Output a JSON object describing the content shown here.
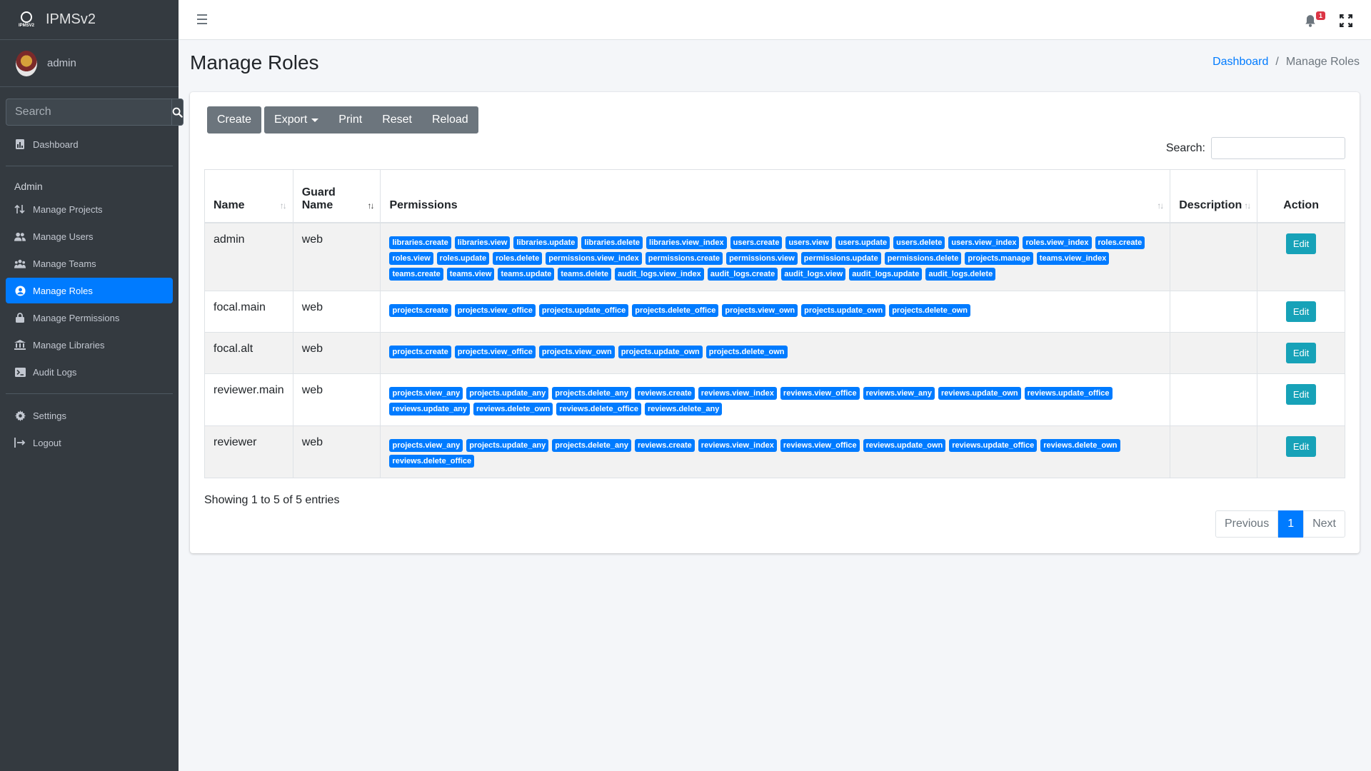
{
  "sidebar": {
    "brand": "IPMSv2",
    "brand_small": "IPMSV2",
    "user": "admin",
    "search_placeholder": "Search",
    "dashboard": "Dashboard",
    "section_header": "Admin",
    "items": [
      {
        "label": "Manage Projects",
        "icon": "sort-arrows-icon"
      },
      {
        "label": "Manage Users",
        "icon": "users-icon"
      },
      {
        "label": "Manage Teams",
        "icon": "teams-icon"
      },
      {
        "label": "Manage Roles",
        "icon": "user-circle-icon"
      },
      {
        "label": "Manage Permissions",
        "icon": "lock-icon"
      },
      {
        "label": "Manage Libraries",
        "icon": "library-icon"
      },
      {
        "label": "Audit Logs",
        "icon": "terminal-icon"
      }
    ],
    "settings": "Settings",
    "logout": "Logout"
  },
  "topbar": {
    "notification_count": "1"
  },
  "header": {
    "title": "Manage Roles",
    "breadcrumb_home": "Dashboard",
    "breadcrumb_sep": "/",
    "breadcrumb_current": "Manage Roles"
  },
  "toolbar": {
    "create": "Create",
    "export": "Export",
    "print": "Print",
    "reset": "Reset",
    "reload": "Reload"
  },
  "search_label": "Search:",
  "table": {
    "columns": [
      "Name",
      "Guard Name",
      "Permissions",
      "Description",
      "Action"
    ],
    "guard_line1": "Guard",
    "guard_line2": "Name",
    "rows": [
      {
        "name": "admin",
        "guard": "web",
        "description": "",
        "action": "Edit",
        "permissions": [
          "libraries.create",
          "libraries.view",
          "libraries.update",
          "libraries.delete",
          "libraries.view_index",
          "users.create",
          "users.view",
          "users.update",
          "users.delete",
          "users.view_index",
          "roles.view_index",
          "roles.create",
          "roles.view",
          "roles.update",
          "roles.delete",
          "permissions.view_index",
          "permissions.create",
          "permissions.view",
          "permissions.update",
          "permissions.delete",
          "projects.manage",
          "teams.view_index",
          "teams.create",
          "teams.view",
          "teams.update",
          "teams.delete",
          "audit_logs.view_index",
          "audit_logs.create",
          "audit_logs.view",
          "audit_logs.update",
          "audit_logs.delete"
        ]
      },
      {
        "name": "focal.main",
        "guard": "web",
        "description": "",
        "action": "Edit",
        "permissions": [
          "projects.create",
          "projects.view_office",
          "projects.update_office",
          "projects.delete_office",
          "projects.view_own",
          "projects.update_own",
          "projects.delete_own"
        ]
      },
      {
        "name": "focal.alt",
        "guard": "web",
        "description": "",
        "action": "Edit",
        "permissions": [
          "projects.create",
          "projects.view_office",
          "projects.view_own",
          "projects.update_own",
          "projects.delete_own"
        ]
      },
      {
        "name": "reviewer.main",
        "guard": "web",
        "description": "",
        "action": "Edit",
        "permissions": [
          "projects.view_any",
          "projects.update_any",
          "projects.delete_any",
          "reviews.create",
          "reviews.view_index",
          "reviews.view_office",
          "reviews.view_any",
          "reviews.update_own",
          "reviews.update_office",
          "reviews.update_any",
          "reviews.delete_own",
          "reviews.delete_office",
          "reviews.delete_any"
        ]
      },
      {
        "name": "reviewer",
        "guard": "web",
        "description": "",
        "action": "Edit",
        "permissions": [
          "projects.view_any",
          "projects.update_any",
          "projects.delete_any",
          "reviews.create",
          "reviews.view_index",
          "reviews.view_office",
          "reviews.update_own",
          "reviews.update_office",
          "reviews.delete_own",
          "reviews.delete_office"
        ]
      }
    ]
  },
  "footer": {
    "showing": "Showing 1 to 5 of 5 entries",
    "previous": "Previous",
    "page": "1",
    "next": "Next"
  },
  "colors": {
    "sidebar_bg": "#343a40",
    "primary": "#007bff",
    "info": "#17a2b8",
    "secondary": "#6c757d",
    "danger": "#dc3545"
  }
}
